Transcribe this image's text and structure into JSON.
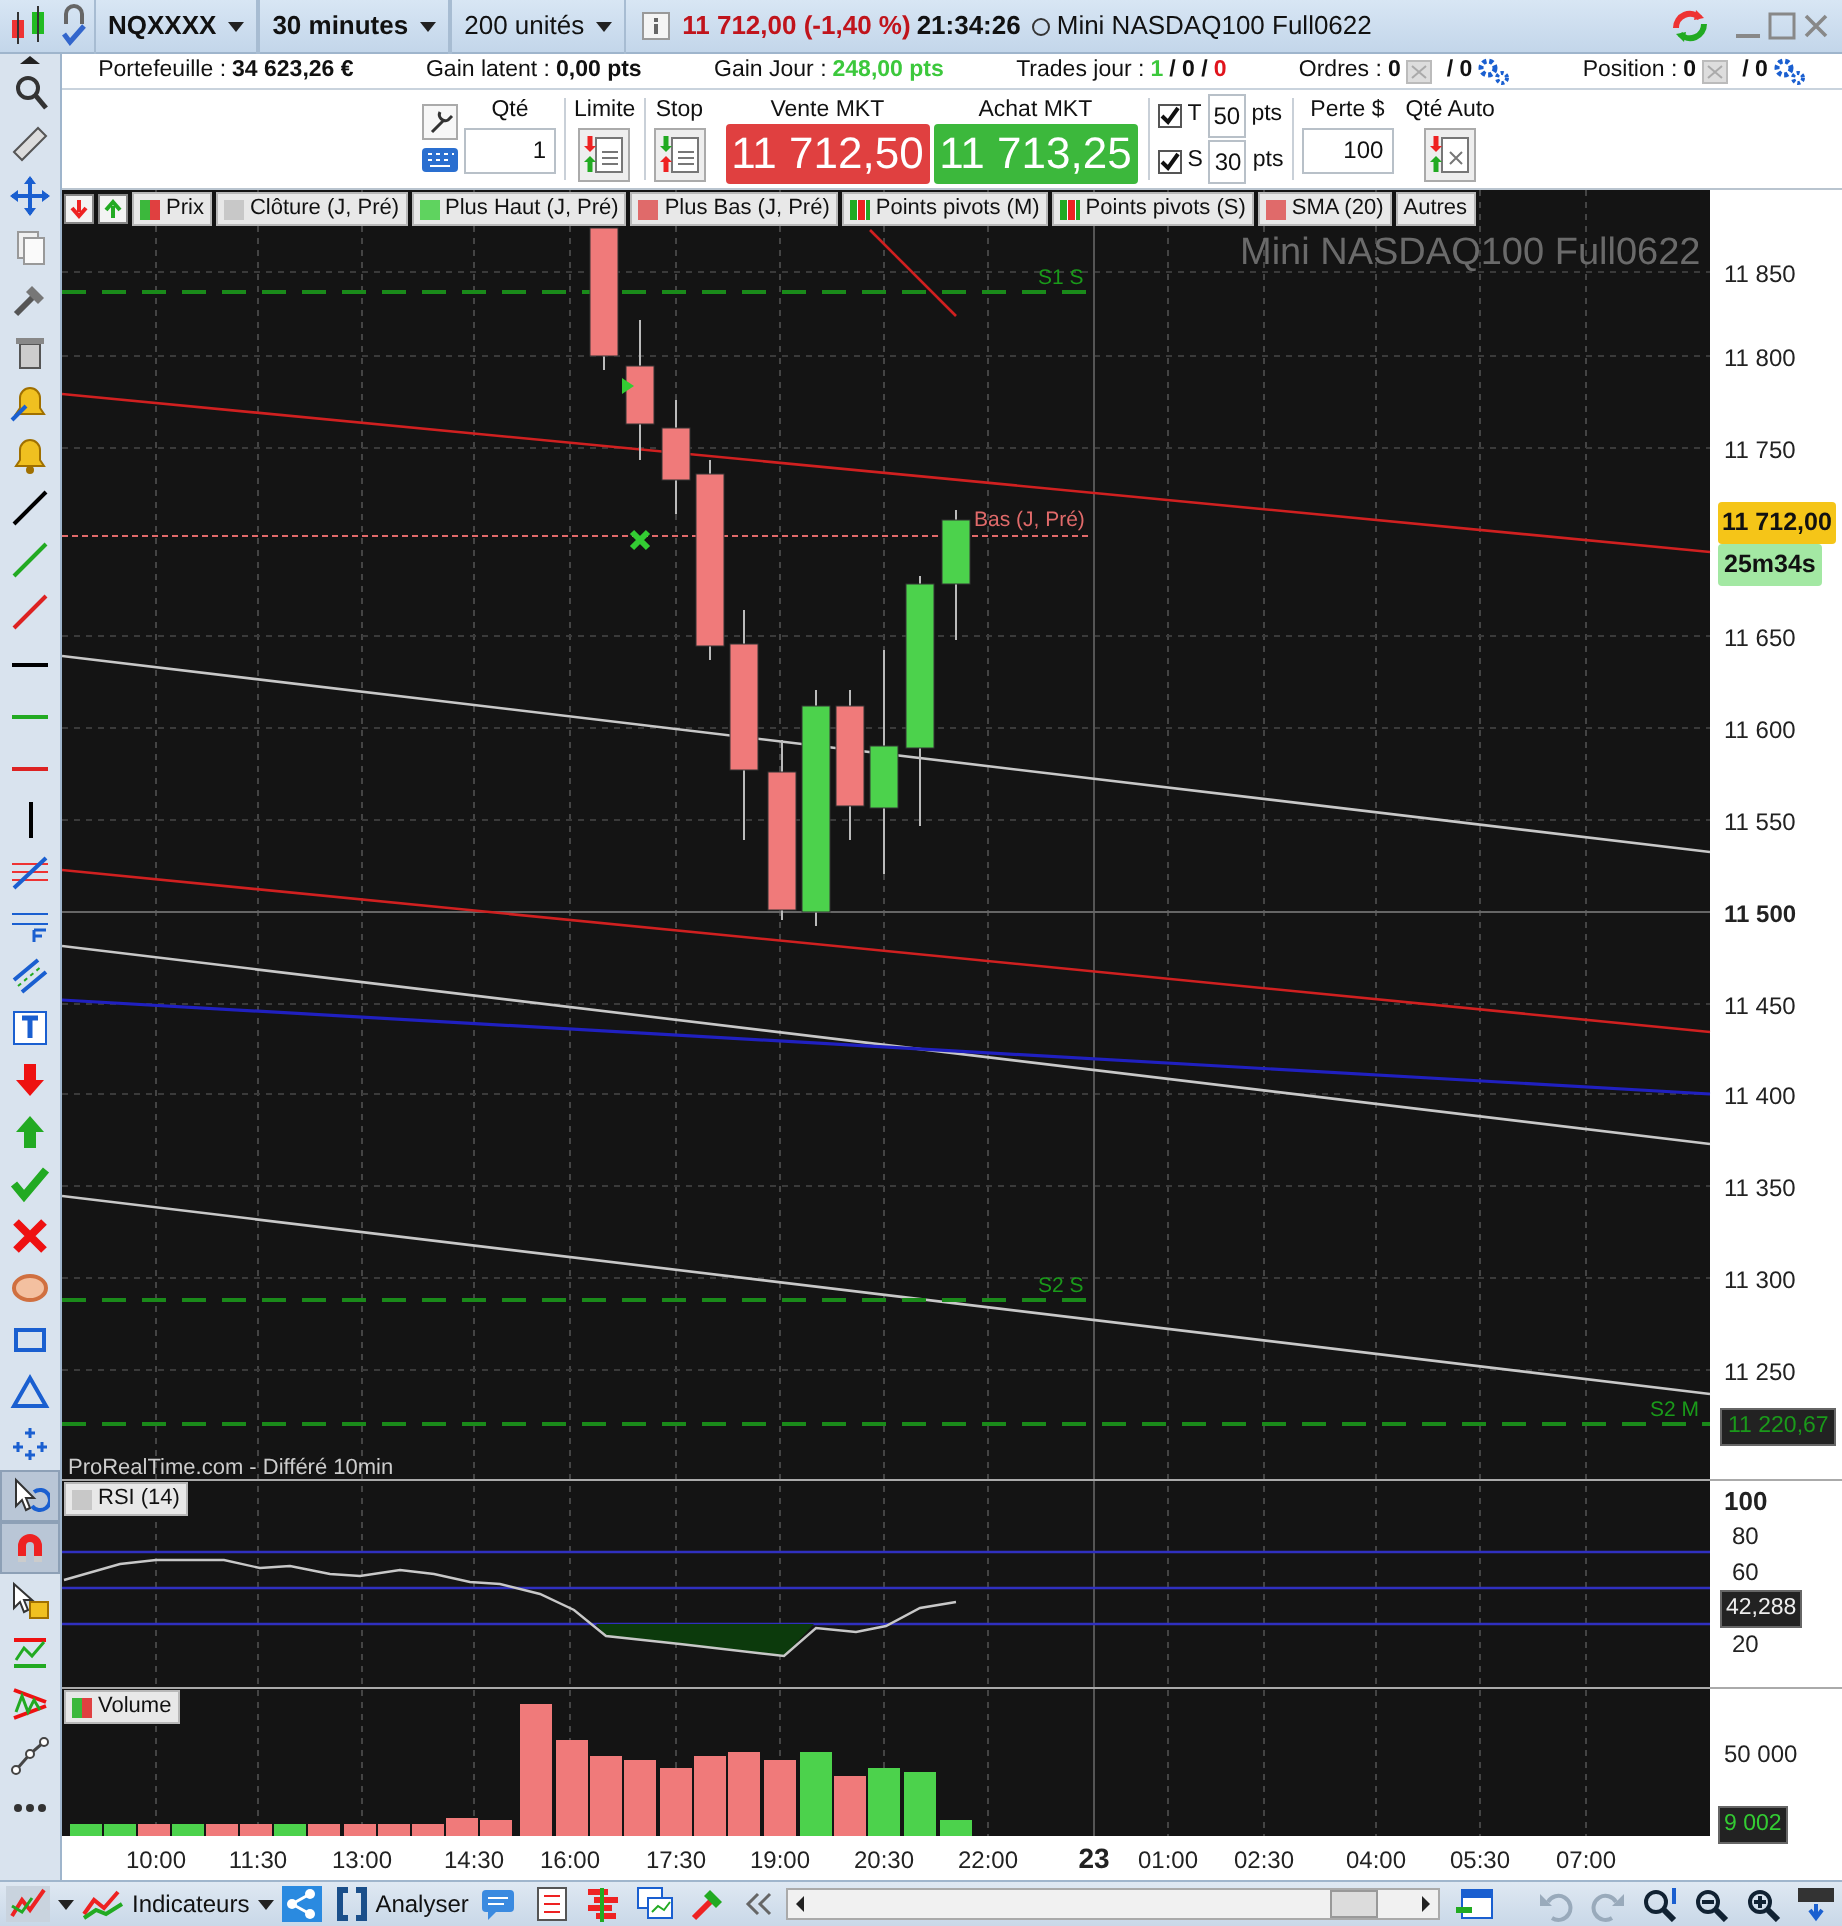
{
  "title_bar": {
    "symbol": "NQXXXX",
    "interval": "30 minutes",
    "units": "200 unités",
    "quote": "11 712,00 (-1,40 %)",
    "time": "21:34:26",
    "instrument": "Mini NASDAQ100 Full0622"
  },
  "account_bar": [
    {
      "kind": "value",
      "label": "Portefeuille :",
      "value": "34 623,26 €",
      "color": "#111111"
    },
    {
      "kind": "value",
      "label": "Gain latent :",
      "value": "0,00 pts",
      "color": "#111111"
    },
    {
      "kind": "value",
      "label": "Gain Jour :",
      "value": "248,00 pts",
      "color": "#3cc83c"
    },
    {
      "kind": "trades",
      "label": "Trades jour :",
      "parts": [
        {
          "text": "1",
          "color": "#3cc83c"
        },
        {
          "text": "/ 0 /",
          "color": "#111111"
        },
        {
          "text": "0",
          "color": "#e0141c"
        }
      ]
    },
    {
      "kind": "counter",
      "label": "Ordres :",
      "count": "0",
      "total": "/ 0"
    },
    {
      "kind": "counter",
      "label": "Position :",
      "count": "0",
      "total": "/ 0"
    }
  ],
  "order_panel": {
    "qty_label": "Qté",
    "qty_value": "1",
    "limit_label": "Limite",
    "stop_label": "Stop",
    "sell_label": "Vente MKT",
    "sell_price": "11 712,50",
    "buy_label": "Achat MKT",
    "buy_price": "11 713,25",
    "brackets": [
      {
        "checked": true,
        "letter": "T",
        "value": "50",
        "unit": "pts"
      },
      {
        "checked": true,
        "letter": "S",
        "value": "30",
        "unit": "pts"
      }
    ],
    "loss_label": "Perte $",
    "loss_value": "100",
    "auto_label": "Qté Auto"
  },
  "tools": [
    {
      "kind": "zoom",
      "selected": false
    },
    {
      "kind": "ruler",
      "selected": false
    },
    {
      "kind": "move",
      "selected": false
    },
    {
      "kind": "copy",
      "selected": false
    },
    {
      "kind": "tools",
      "selected": false
    },
    {
      "kind": "trash",
      "selected": false
    },
    {
      "kind": "alert",
      "selected": false
    },
    {
      "kind": "bell",
      "selected": false
    },
    {
      "kind": "line",
      "color": "#000000",
      "selected": false
    },
    {
      "kind": "line",
      "color": "#22aa22",
      "selected": false
    },
    {
      "kind": "line",
      "color": "#dd2222",
      "selected": false
    },
    {
      "kind": "hline",
      "color": "#000000",
      "selected": false
    },
    {
      "kind": "hline",
      "color": "#22aa22",
      "selected": false
    },
    {
      "kind": "hline",
      "color": "#dd2222",
      "selected": false
    },
    {
      "kind": "vline",
      "color": "#000000",
      "selected": false
    },
    {
      "kind": "fib",
      "selected": false
    },
    {
      "kind": "fibf",
      "selected": false
    },
    {
      "kind": "channel",
      "selected": false
    },
    {
      "kind": "text",
      "selected": false
    },
    {
      "kind": "down",
      "selected": false
    },
    {
      "kind": "up",
      "selected": false
    },
    {
      "kind": "check",
      "selected": false
    },
    {
      "kind": "cross",
      "selected": false
    },
    {
      "kind": "ellipse",
      "selected": false
    },
    {
      "kind": "rect",
      "selected": false
    },
    {
      "kind": "triangle",
      "selected": false
    },
    {
      "kind": "points",
      "selected": false
    },
    {
      "kind": "cursor",
      "selected": true
    },
    {
      "kind": "magnet",
      "selected": true
    },
    {
      "kind": "lock",
      "selected": false
    },
    {
      "kind": "pattern",
      "selected": false
    },
    {
      "kind": "wedge",
      "selected": false
    },
    {
      "kind": "nodes",
      "selected": false
    },
    {
      "kind": "more",
      "selected": false
    }
  ],
  "indicator_tabs": [
    {
      "label": "Prix",
      "kind": "split"
    },
    {
      "label": "Clôture (J, Pré)",
      "kind": "solid",
      "color": "#c8c8c8"
    },
    {
      "label": "Plus Haut (J, Pré)",
      "kind": "solid",
      "color": "#5fd35f"
    },
    {
      "label": "Plus Bas (J, Pré)",
      "kind": "solid",
      "color": "#e06a6a"
    },
    {
      "label": "Points pivots (M)",
      "kind": "striped"
    },
    {
      "label": "Points pivots (S)",
      "kind": "striped"
    },
    {
      "label": "SMA (20)",
      "kind": "solid",
      "color": "#e06a6a"
    },
    {
      "label": "Autres",
      "kind": "none"
    }
  ],
  "chart": {
    "watermark": "Mini NASDAQ100 Full0622",
    "level_labels": [
      {
        "text": "S1 S",
        "kind": "support"
      },
      {
        "text": "Bas (J, Pré)",
        "kind": "low"
      },
      {
        "text": "S2 S",
        "kind": "support"
      },
      {
        "text": "S2 M",
        "kind": "support"
      }
    ],
    "price_ticks": [
      {
        "label": "11 850",
        "major": false
      },
      {
        "label": "11 800",
        "major": false
      },
      {
        "label": "11 750",
        "major": false
      },
      {
        "label": "11 650",
        "major": false
      },
      {
        "label": "11 600",
        "major": false
      },
      {
        "label": "11 550",
        "major": false
      },
      {
        "label": "11 500",
        "major": true
      },
      {
        "label": "11 450",
        "major": false
      },
      {
        "label": "11 400",
        "major": false
      },
      {
        "label": "11 350",
        "major": false
      },
      {
        "label": "11 300",
        "major": false
      },
      {
        "label": "11 250",
        "major": false
      }
    ],
    "last_price": "11 712,00",
    "countdown": "25m34s",
    "s2m_price": "11 220,67",
    "source": "ProRealTime.com - Différé 10min"
  },
  "rsi": {
    "label": "RSI (14)",
    "ticks": [
      "100",
      "80",
      "60",
      "20"
    ],
    "value": "42,288"
  },
  "volume": {
    "label": "Volume",
    "tick": "50 000",
    "value": "9 002"
  },
  "time_axis": [
    {
      "label": "10:00",
      "major": false
    },
    {
      "label": "11:30",
      "major": false
    },
    {
      "label": "13:00",
      "major": false
    },
    {
      "label": "14:30",
      "major": false
    },
    {
      "label": "16:00",
      "major": false
    },
    {
      "label": "17:30",
      "major": false
    },
    {
      "label": "19:00",
      "major": false
    },
    {
      "label": "20:30",
      "major": false
    },
    {
      "label": "22:00",
      "major": false
    },
    {
      "label": "23",
      "major": true
    },
    {
      "label": "01:00",
      "major": false
    },
    {
      "label": "02:30",
      "major": false
    },
    {
      "label": "04:00",
      "major": false
    },
    {
      "label": "05:30",
      "major": false
    },
    {
      "label": "07:00",
      "major": false
    }
  ],
  "bottom_bar": {
    "indicators_label": "Indicateurs",
    "analyse_label": "Analyser"
  }
}
